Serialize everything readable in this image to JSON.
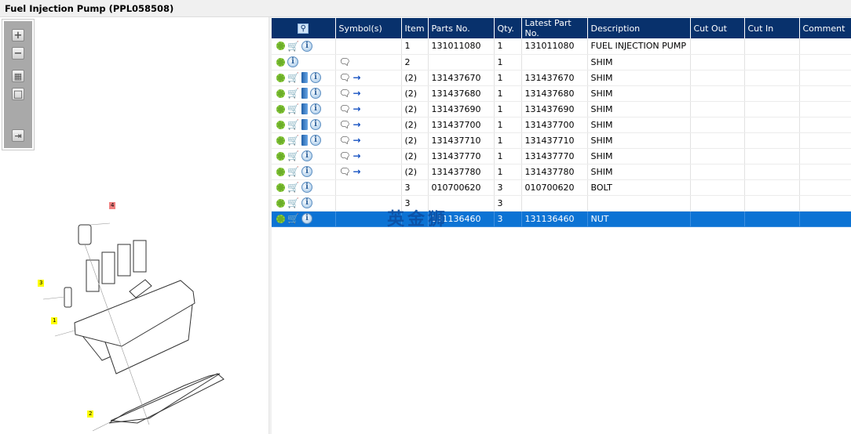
{
  "title": "Fuel Injection Pump (PPL058508)",
  "watermark": "英金狮",
  "toolbar": {
    "zoom_in": "+",
    "zoom_out": "−",
    "fit": "▦",
    "actual": "□",
    "toggle": "⇥"
  },
  "callouts": [
    "1",
    "2",
    "3",
    "4"
  ],
  "columns": [
    "",
    "Symbol(s)",
    "Item",
    "Parts No.",
    "Qty.",
    "Latest Part No.",
    "Description",
    "Cut Out",
    "Cut In",
    "Comment"
  ],
  "rows": [
    {
      "cart": true,
      "book": false,
      "note": false,
      "repl": false,
      "item": "1",
      "part": "131011080",
      "qty": "1",
      "latest": "131011080",
      "desc": "FUEL INJECTION PUMP"
    },
    {
      "cart": false,
      "book": false,
      "note": true,
      "repl": false,
      "item": "2",
      "part": "",
      "qty": "1",
      "latest": "",
      "desc": "SHIM"
    },
    {
      "cart": true,
      "book": true,
      "note": true,
      "repl": true,
      "item": "(2)",
      "part": "131437670",
      "qty": "1",
      "latest": "131437670",
      "desc": "SHIM"
    },
    {
      "cart": true,
      "book": true,
      "note": true,
      "repl": true,
      "item": "(2)",
      "part": "131437680",
      "qty": "1",
      "latest": "131437680",
      "desc": "SHIM"
    },
    {
      "cart": true,
      "book": true,
      "note": true,
      "repl": true,
      "item": "(2)",
      "part": "131437690",
      "qty": "1",
      "latest": "131437690",
      "desc": "SHIM"
    },
    {
      "cart": true,
      "book": true,
      "note": true,
      "repl": true,
      "item": "(2)",
      "part": "131437700",
      "qty": "1",
      "latest": "131437700",
      "desc": "SHIM"
    },
    {
      "cart": true,
      "book": true,
      "note": true,
      "repl": true,
      "item": "(2)",
      "part": "131437710",
      "qty": "1",
      "latest": "131437710",
      "desc": "SHIM"
    },
    {
      "cart": true,
      "book": false,
      "note": true,
      "repl": true,
      "item": "(2)",
      "part": "131437770",
      "qty": "1",
      "latest": "131437770",
      "desc": "SHIM"
    },
    {
      "cart": true,
      "book": false,
      "note": true,
      "repl": true,
      "item": "(2)",
      "part": "131437780",
      "qty": "1",
      "latest": "131437780",
      "desc": "SHIM"
    },
    {
      "cart": true,
      "book": false,
      "note": false,
      "repl": false,
      "item": "3",
      "part": "010700620",
      "qty": "3",
      "latest": "010700620",
      "desc": "BOLT"
    },
    {
      "cart": true,
      "book": false,
      "note": false,
      "repl": false,
      "item": "3",
      "part": "",
      "qty": "3",
      "latest": "",
      "desc": ""
    },
    {
      "cart": true,
      "book": false,
      "note": false,
      "repl": false,
      "item": "",
      "part": "131136460",
      "qty": "3",
      "latest": "131136460",
      "desc": "NUT",
      "selected": true
    }
  ]
}
